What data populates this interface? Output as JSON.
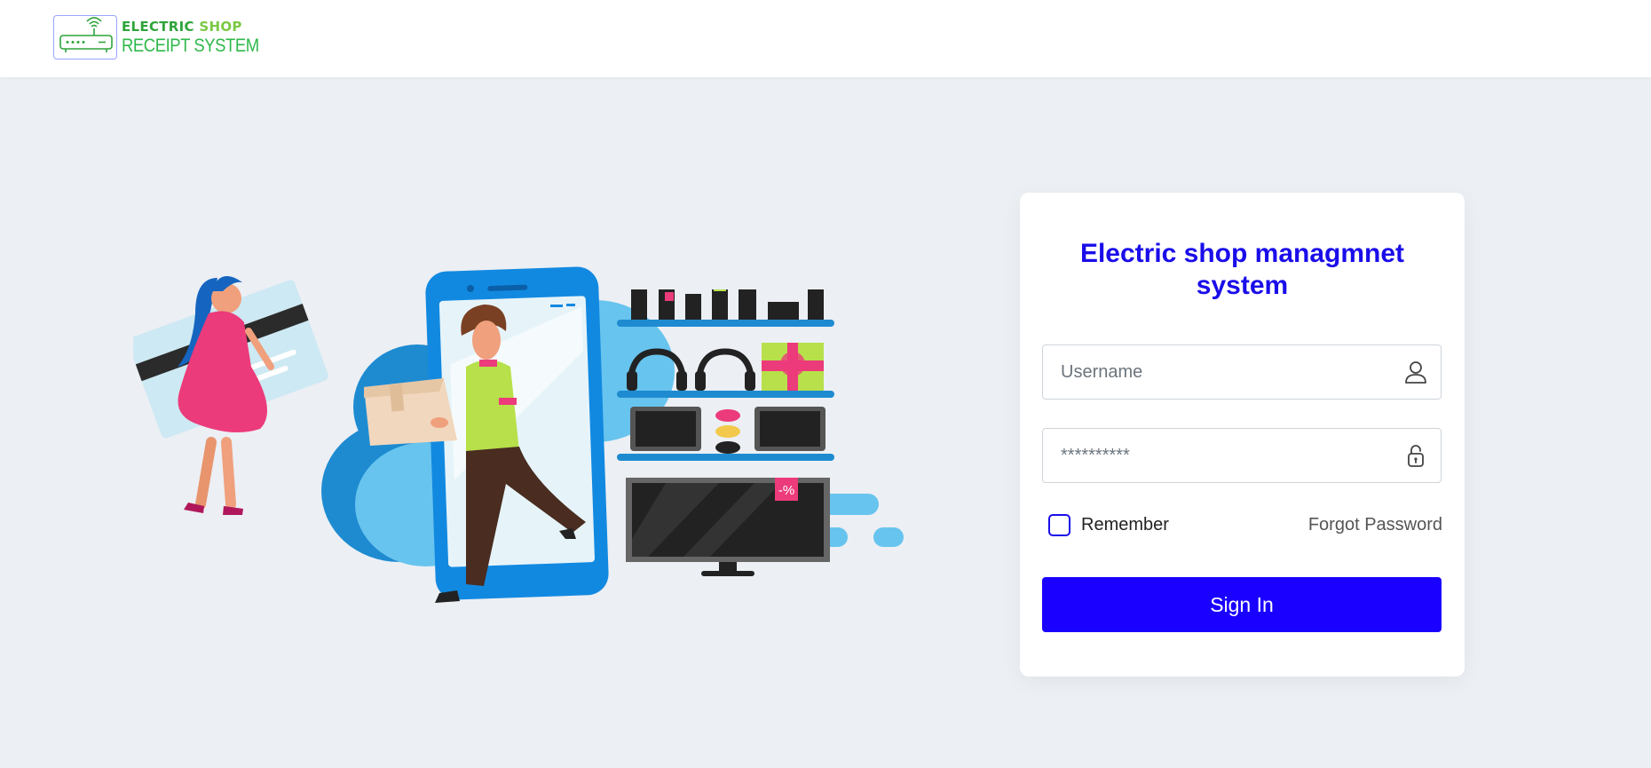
{
  "header": {
    "logo": {
      "line1_part1": "ELECTRIC",
      "line1_part2": "SHOP",
      "line2": "RECEIPT SYSTEM",
      "icon": "router-icon",
      "colors": {
        "primary": "#2fa43a",
        "secondary": "#7ac943",
        "border": "#9aa4ff"
      }
    }
  },
  "illustration": {
    "description_icon": "electronics-shop-illustration",
    "badge_text": "-%"
  },
  "login": {
    "title": "Electric shop managmnet system",
    "username": {
      "placeholder": "Username",
      "value": "",
      "icon": "user-icon"
    },
    "password": {
      "placeholder": "**********",
      "value": "",
      "icon": "lock-icon"
    },
    "remember_label": "Remember",
    "remember_checked": false,
    "forgot_label": "Forgot Password",
    "signin_label": "Sign In"
  },
  "colors": {
    "accent": "#1a00ff",
    "title": "#1a0dea",
    "background": "#eceff4",
    "card": "#ffffff"
  }
}
